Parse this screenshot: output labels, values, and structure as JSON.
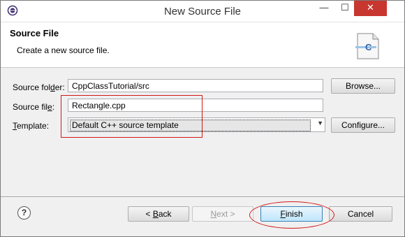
{
  "window": {
    "title": "New Source File",
    "minimize_glyph": "—",
    "maximize_glyph": "☐",
    "close_glyph": "✕",
    "close_color": "#c7372f"
  },
  "header": {
    "title": "Source File",
    "subtitle": "Create a new source file.",
    "icon": "c-source-file-icon",
    "icon_letter": "C"
  },
  "form": {
    "source_folder": {
      "label_pre": "Source fol",
      "label_mnemonic": "d",
      "label_post": "er:",
      "value": "CppClassTutorial/src",
      "button": "Browse..."
    },
    "source_file": {
      "label_pre": "Source fil",
      "label_mnemonic": "e",
      "label_post": ":",
      "value": "Rectangle.cpp"
    },
    "template": {
      "label_pre": "",
      "label_mnemonic": "T",
      "label_post": "emplate:",
      "selected": "Default C++ source template",
      "button": "Configure..."
    }
  },
  "footer": {
    "help_glyph": "?",
    "back": {
      "pre": "< ",
      "mnemonic": "B",
      "post": "ack"
    },
    "next": {
      "pre": "",
      "mnemonic": "N",
      "post": "ext >"
    },
    "finish": {
      "pre": "",
      "mnemonic": "F",
      "post": "inish"
    },
    "cancel": "Cancel"
  },
  "annotation_color": "#d21818"
}
